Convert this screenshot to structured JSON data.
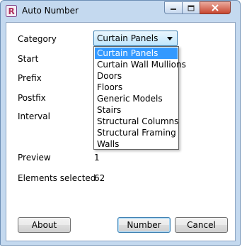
{
  "window": {
    "title": "Auto Number"
  },
  "form": {
    "category_label": "Category",
    "start_label": "Start",
    "prefix_label": "Prefix",
    "postfix_label": "Postfix",
    "interval_label": "Interval",
    "preview_label": "Preview",
    "preview_value": "1",
    "elements_selected_label": "Elements selected",
    "elements_selected_value": "62"
  },
  "category_select": {
    "selected": "Curtain Panels",
    "options": [
      "Curtain Panels",
      "Curtain Wall Mullions",
      "Doors",
      "Floors",
      "Generic Models",
      "Stairs",
      "Structural Columns",
      "Structural Framing",
      "Walls"
    ]
  },
  "buttons": {
    "about": "About",
    "number": "Number",
    "cancel": "Cancel"
  },
  "colors": {
    "selection": "#3399ff",
    "window_frame": "#c4d9ef",
    "close_button": "#c8462f"
  }
}
